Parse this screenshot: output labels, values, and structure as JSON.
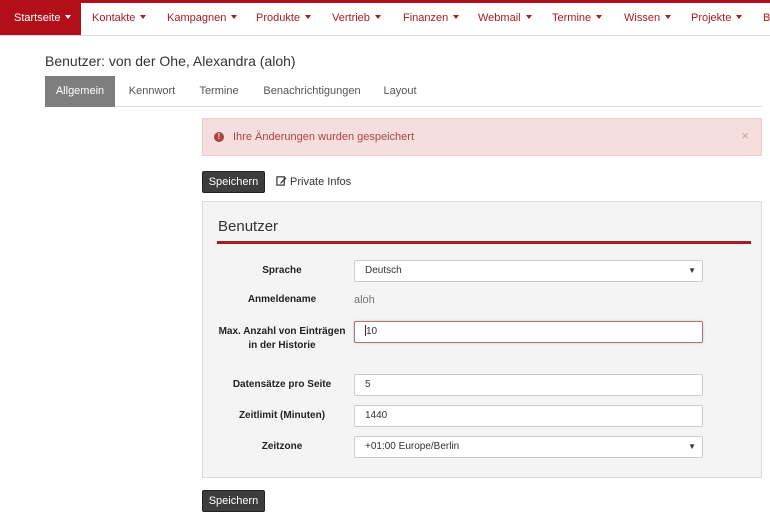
{
  "nav": {
    "items": [
      {
        "label": "Startseite",
        "active": true
      },
      {
        "label": "Kontakte"
      },
      {
        "label": "Kampagnen"
      },
      {
        "label": "Produkte"
      },
      {
        "label": "Vertrieb"
      },
      {
        "label": "Finanzen"
      },
      {
        "label": "Webmail"
      },
      {
        "label": "Termine"
      },
      {
        "label": "Wissen"
      },
      {
        "label": "Projekte"
      },
      {
        "label": "B"
      }
    ]
  },
  "page": {
    "title": "Benutzer: von der Ohe, Alexandra (aloh)"
  },
  "tabs": [
    {
      "label": "Allgemein",
      "active": true
    },
    {
      "label": "Kennwort"
    },
    {
      "label": "Termine"
    },
    {
      "label": "Benachrichtigungen"
    },
    {
      "label": "Layout"
    }
  ],
  "alert": {
    "message": "Ihre Änderungen wurden gespeichert",
    "close_symbol": "×",
    "icon_symbol": "!"
  },
  "toolbar": {
    "save_label": "Speichern",
    "private_info_label": "Private Infos"
  },
  "panel": {
    "title": "Benutzer",
    "fields": {
      "language": {
        "label": "Sprache",
        "value": "Deutsch"
      },
      "login_name": {
        "label": "Anmeldename",
        "value": "aloh"
      },
      "max_history": {
        "label": "Max. Anzahl von Einträgen in der Historie",
        "value": "10"
      },
      "records_per_page": {
        "label": "Datensätze pro Seite",
        "value": "5"
      },
      "time_limit": {
        "label": "Zeitlimit (Minuten)",
        "value": "1440"
      },
      "timezone": {
        "label": "Zeitzone",
        "value": "+01:00 Europe/Berlin"
      }
    }
  },
  "footer": {
    "save_label": "Speichern"
  },
  "colors": {
    "brand_red": "#b30f1a",
    "nav_text": "#a41e22",
    "alert_bg": "#f6dede",
    "alert_text": "#a94442",
    "button_dark": "#3d3d3d",
    "tab_active": "#7e7e7e"
  },
  "icons": {
    "nav_dropdown": "chevron-down-icon",
    "alert": "exclamation-circle-icon",
    "private_info": "edit-icon",
    "select": "chevron-down-icon"
  }
}
